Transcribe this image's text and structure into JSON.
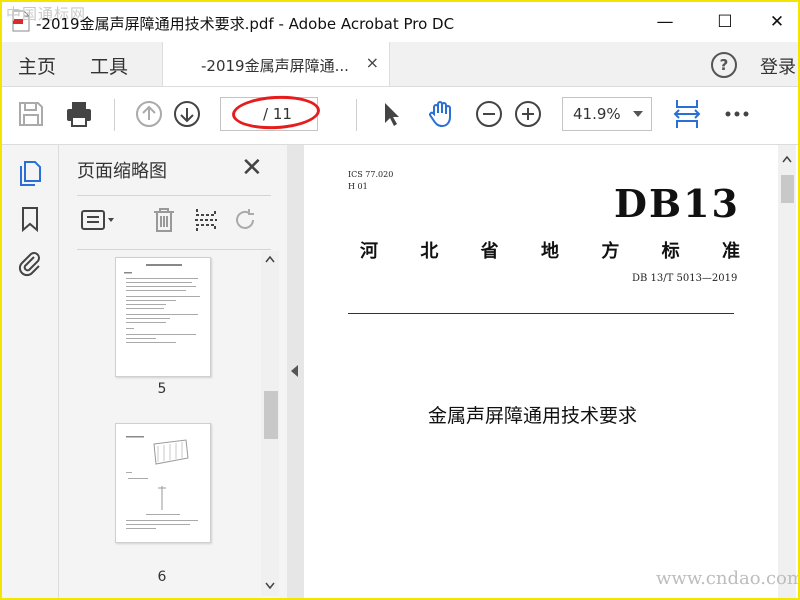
{
  "watermark_top": "中国通标网",
  "window": {
    "title": "-2019金属声屏障通用技术要求.pdf - Adobe Acrobat Pro DC",
    "minimize": "—",
    "maximize": "☐",
    "close": "✕"
  },
  "tabs": {
    "home": "主页",
    "tools": "工具",
    "doc_tab": "-2019金属声屏障通...",
    "doc_tab_close": "×",
    "help": "?",
    "login": "登录"
  },
  "toolbar": {
    "page_current": "",
    "page_total": "/ 11",
    "zoom": "41.9%",
    "icons": [
      "save-icon",
      "print-icon",
      "page-up-icon",
      "page-down-icon",
      "select-arrow-icon",
      "hand-tool-icon",
      "zoom-out-icon",
      "zoom-in-icon",
      "fit-page-icon",
      "more-icon"
    ]
  },
  "rail": {
    "icons": [
      "page-thumbnails-icon",
      "bookmarks-icon",
      "attachments-icon"
    ]
  },
  "thumbnail_panel": {
    "title": "页面缩略图",
    "close": "✕",
    "pages": [
      {
        "number": "5"
      },
      {
        "number": "6"
      }
    ]
  },
  "document": {
    "ics": "ICS 77.020",
    "h": "H 01",
    "code": "DB13",
    "region_chars": [
      "河",
      "北",
      "省",
      "地",
      "方",
      "标",
      "准"
    ],
    "std_number": "DB 13/T 5013—2019",
    "title": "金属声屏障通用技术要求"
  },
  "watermark_bottom": "www.cndao.com",
  "colors": {
    "accent_blue": "#2a6fd6",
    "annotation_red": "#e51d1d",
    "frame_yellow": "#f2e600"
  }
}
